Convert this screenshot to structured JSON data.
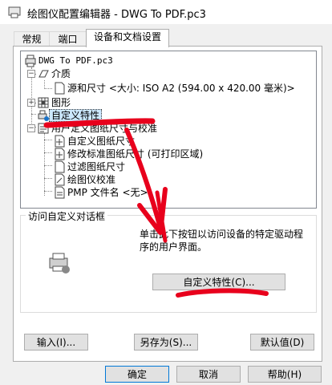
{
  "window": {
    "title": "绘图仪配置编辑器 - DWG To PDF.pc3"
  },
  "tabs": [
    {
      "label": "常规"
    },
    {
      "label": "端口"
    },
    {
      "label": "设备和文档设置"
    }
  ],
  "tree": {
    "root": "DWG To PDF.pc3",
    "media": "介质",
    "source_size": "源和尺寸 <大小: ISO A2 (594.00 x 420.00 毫米)>",
    "graphics": "图形",
    "custom_props": "自定义特性",
    "user_paper": "用户定义图纸尺寸与校准",
    "custom_paper": "自定义图纸尺寸",
    "modify_paper": "修改标准图纸尺寸 (可打印区域)",
    "filter_paper": "过滤图纸尺寸",
    "calibration": "绘图仪校准",
    "pmp": "PMP 文件名 <无>"
  },
  "group": {
    "title": "访问自定义对话框",
    "description": "单击此下按钮以访问设备的特定驱动程序的用户界面。",
    "custom_button": "自定义特性(C)..."
  },
  "bottom": {
    "import": "输入(I)...",
    "save_as": "另存为(S)...",
    "defaults": "默认值(D)"
  },
  "footer": {
    "ok": "确定",
    "cancel": "取消",
    "help": "帮助(H)"
  },
  "colors": {
    "annotation": "#e8001c",
    "selection": "#cce8ff",
    "default_border": "#0078d7"
  }
}
